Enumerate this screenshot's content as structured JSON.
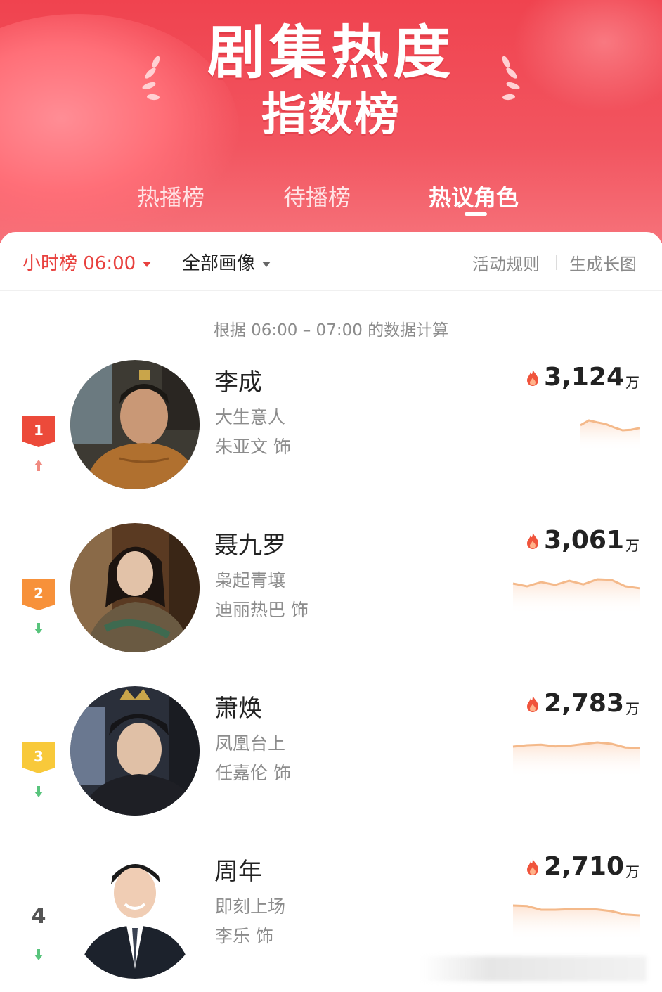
{
  "header": {
    "title_line1": "剧集热度",
    "title_line2": "指数榜",
    "tabs": [
      {
        "label": "热播榜",
        "active": false
      },
      {
        "label": "待播榜",
        "active": false
      },
      {
        "label": "热议角色",
        "active": true
      }
    ]
  },
  "filters": {
    "time_label": "小时榜 06:00",
    "portrait_label": "全部画像",
    "rules_label": "活动规则",
    "long_image_label": "生成长图"
  },
  "calc_note": "根据 06:00 – 07:00 的数据计算",
  "colors": {
    "accent": "#e8413e",
    "header_red": "#f0434f",
    "rank1": "#ec4a3a",
    "rank2": "#f7913a",
    "rank3": "#f8c93a",
    "trend_up": "#f08a80",
    "trend_down": "#58c47c",
    "spark_line": "#f4b98a"
  },
  "rankings": [
    {
      "rank": "1",
      "name": "李成",
      "drama": "大生意人",
      "actor": "朱亚文 饰",
      "heat": "3,124",
      "unit": "万",
      "trend": "up",
      "spark": [
        0.62,
        0.45,
        0.52,
        0.58,
        0.7,
        0.8,
        0.78,
        0.72
      ]
    },
    {
      "rank": "2",
      "name": "聂九罗",
      "drama": "枭起青壤",
      "actor": "迪丽热巴 饰",
      "heat": "3,061",
      "unit": "万",
      "trend": "down",
      "spark": [
        0.45,
        0.55,
        0.4,
        0.5,
        0.35,
        0.48,
        0.3,
        0.32,
        0.55,
        0.62
      ]
    },
    {
      "rank": "3",
      "name": "萧焕",
      "drama": "凤凰台上",
      "actor": "任嘉伦 饰",
      "heat": "2,783",
      "unit": "万",
      "trend": "down",
      "spark": [
        0.45,
        0.4,
        0.38,
        0.44,
        0.42,
        0.36,
        0.3,
        0.35,
        0.48,
        0.5
      ]
    },
    {
      "rank": "4",
      "name": "周年",
      "drama": "即刻上场",
      "actor": "李乐 饰",
      "heat": "2,710",
      "unit": "万",
      "trend": "down",
      "spark": [
        0.3,
        0.32,
        0.45,
        0.45,
        0.43,
        0.42,
        0.44,
        0.5,
        0.62,
        0.65
      ]
    }
  ]
}
